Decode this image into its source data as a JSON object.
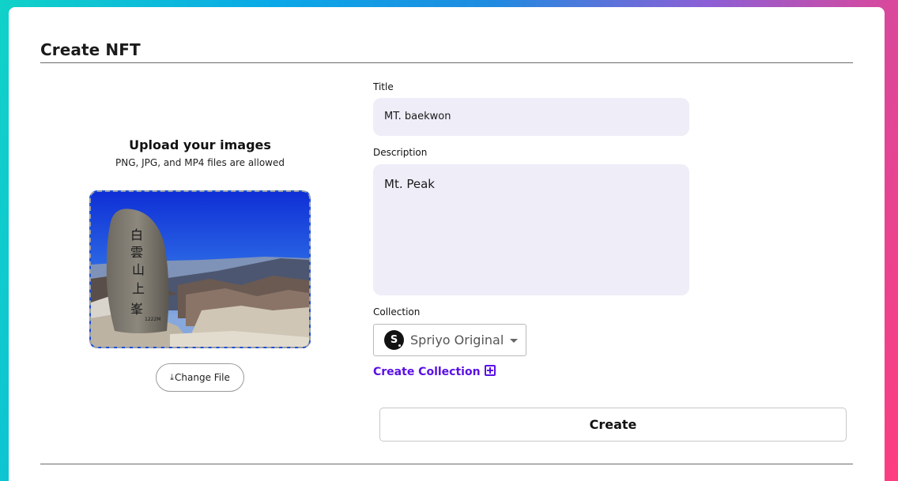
{
  "page": {
    "title": "Create NFT"
  },
  "upload": {
    "heading": "Upload your images",
    "subtext": "PNG, JPG, and MP4 files are allowed",
    "change_file_label": "Change File",
    "change_file_icon": "upload-icon"
  },
  "form": {
    "title_label": "Title",
    "title_value": "MT. baekwon",
    "description_label": "Description",
    "description_value": "Mt. Peak",
    "collection_label": "Collection",
    "collection_selected": "Spriyo Original",
    "collection_avatar_letter": "S",
    "create_collection_label": "Create Collection",
    "create_button_label": "Create"
  },
  "colors": {
    "accent": "#5a10e6",
    "input_bg": "#efedf8"
  }
}
